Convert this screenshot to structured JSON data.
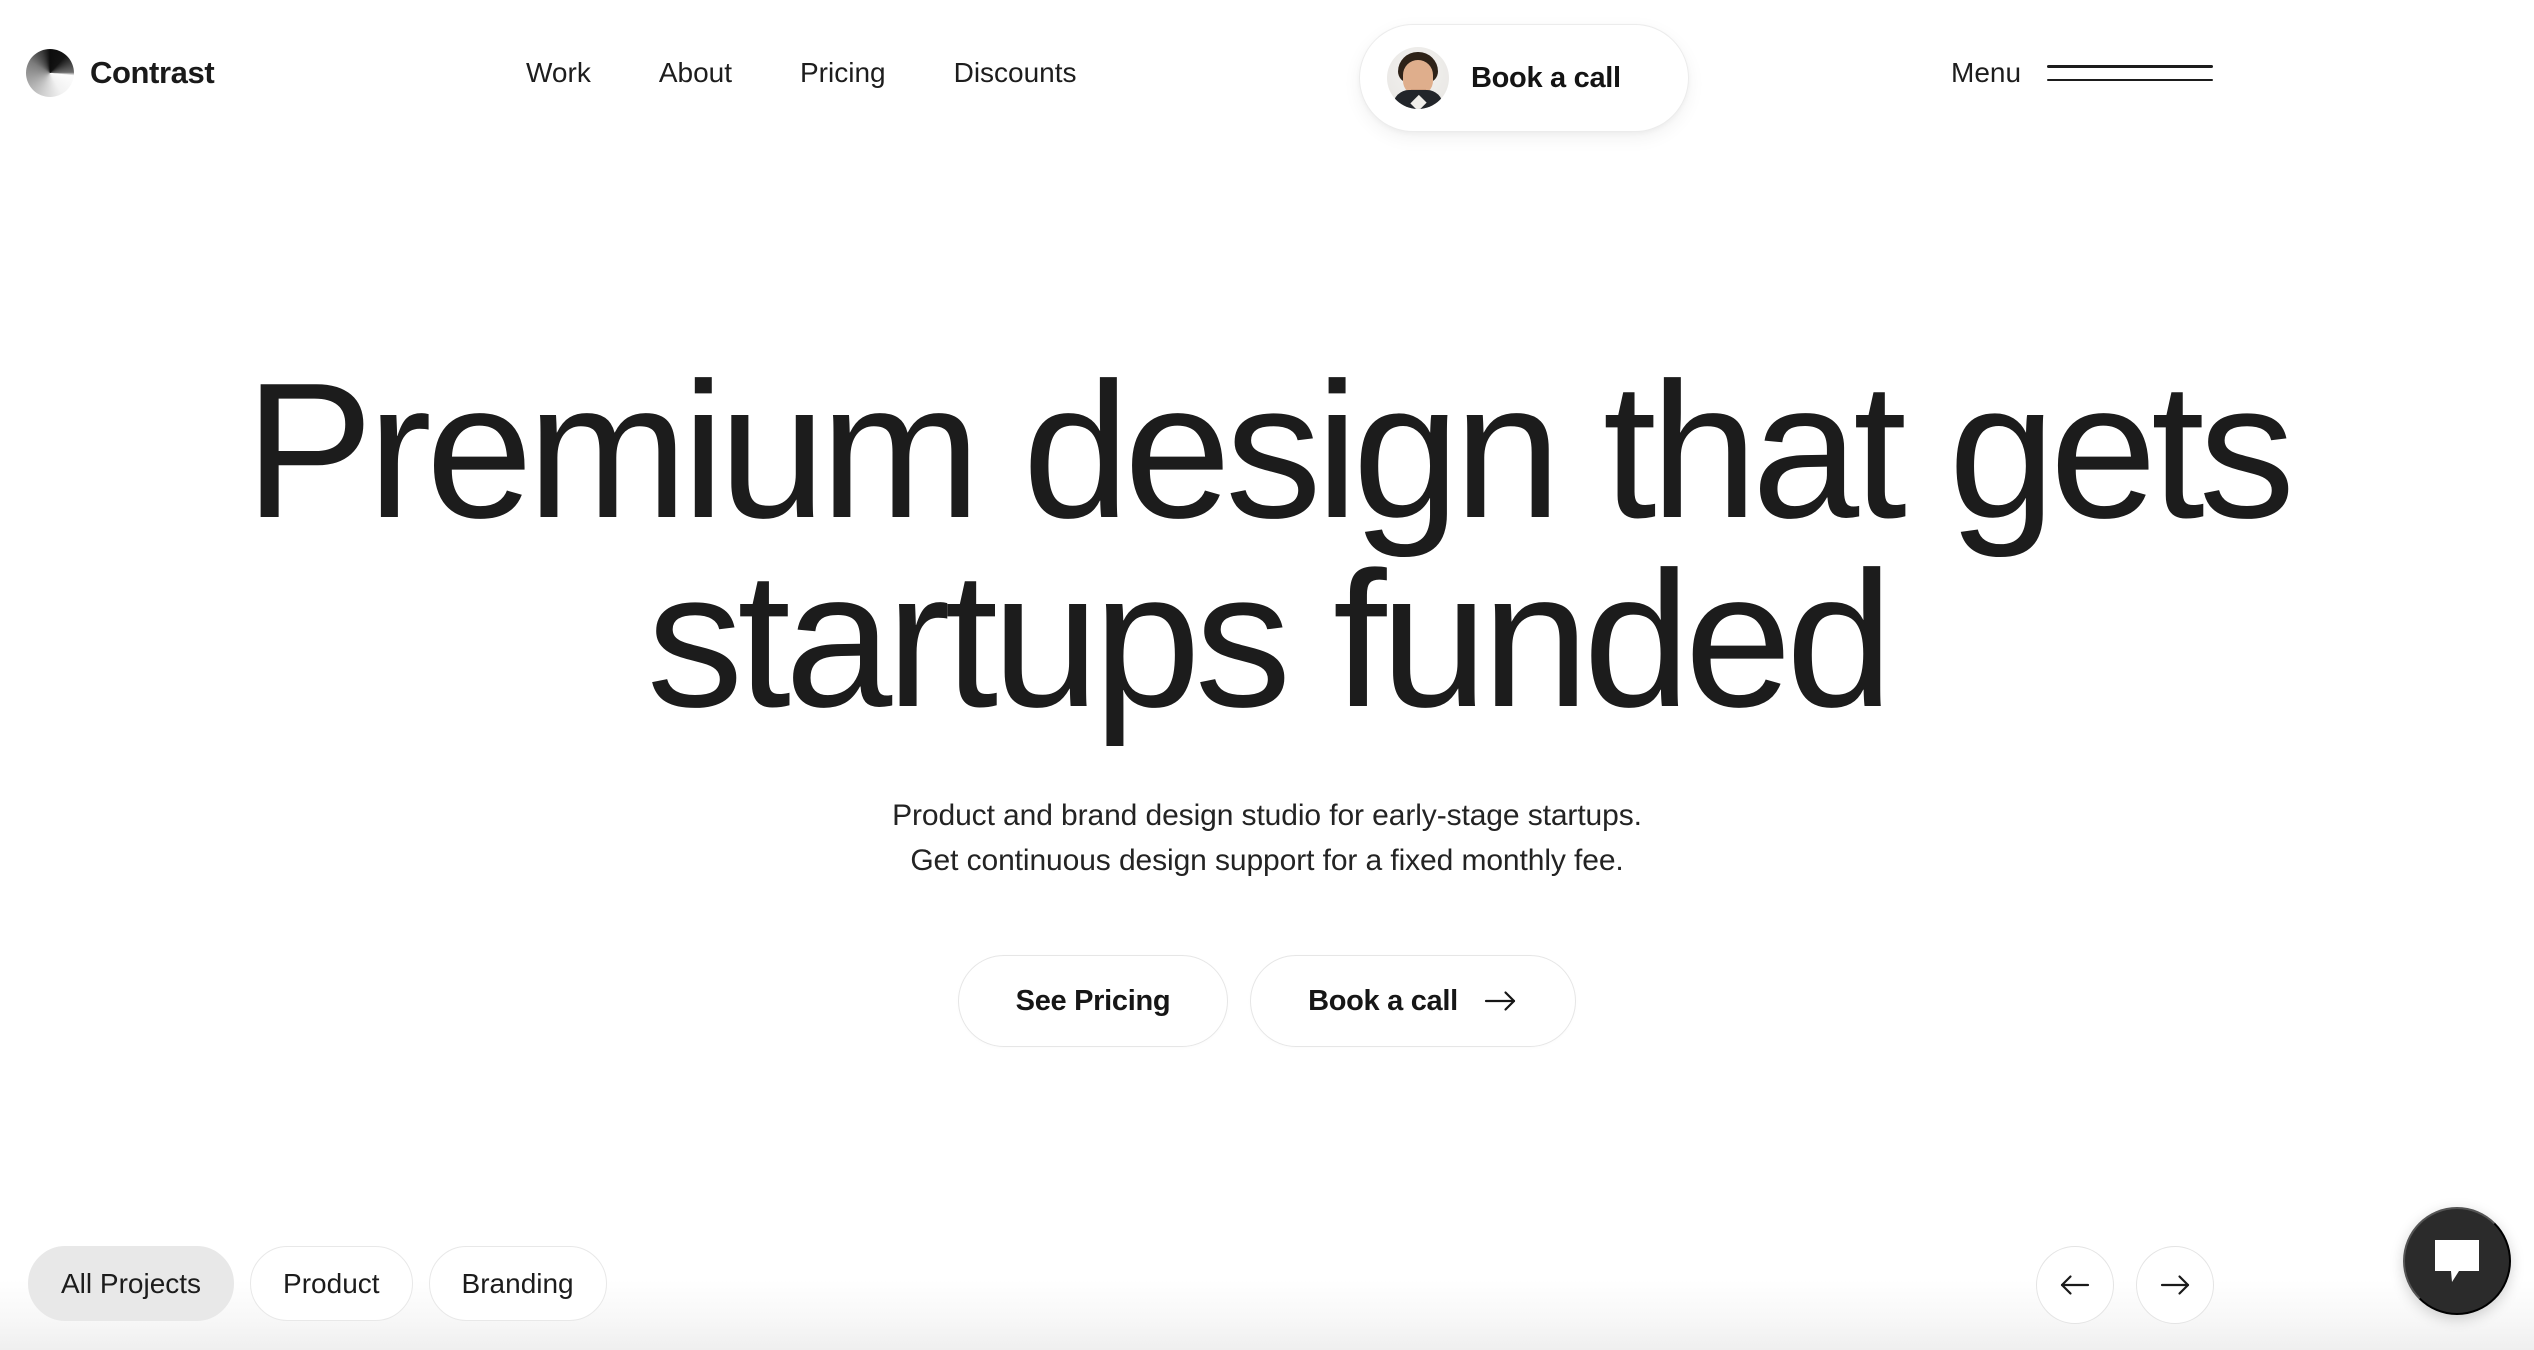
{
  "header": {
    "brand": {
      "name": "Contrast",
      "logo_icon": "contrast-circle-logo-icon"
    },
    "nav_links": [
      {
        "label": "Work"
      },
      {
        "label": "About"
      },
      {
        "label": "Pricing"
      },
      {
        "label": "Discounts"
      }
    ],
    "book_call_pill": {
      "label": "Book a call",
      "avatar_icon": "avatar-photo"
    },
    "menu": {
      "label": "Menu",
      "icon": "hamburger-menu-icon"
    }
  },
  "hero": {
    "title_line1": "Premium design that gets",
    "title_line2": "startups funded",
    "subtitle_line1": "Product and brand design studio for early-stage startups.",
    "subtitle_line2": "Get continuous design support for a fixed monthly fee.",
    "cta_primary": "See Pricing",
    "cta_secondary": "Book a call",
    "cta_secondary_icon": "arrow-right-icon"
  },
  "projects": {
    "filters": [
      {
        "label": "All Projects",
        "active": true
      },
      {
        "label": "Product",
        "active": false
      },
      {
        "label": "Branding",
        "active": false
      }
    ],
    "carousel": {
      "prev_icon": "arrow-left-icon",
      "next_icon": "arrow-right-icon"
    }
  },
  "chat": {
    "icon": "chat-bubble-icon"
  },
  "colors": {
    "background": "#ffffff",
    "text": "#1a1a1a",
    "chip_active_bg": "#e8e8e8",
    "border": "#e6e6e6",
    "chat_bg": "#2b2b2b"
  }
}
